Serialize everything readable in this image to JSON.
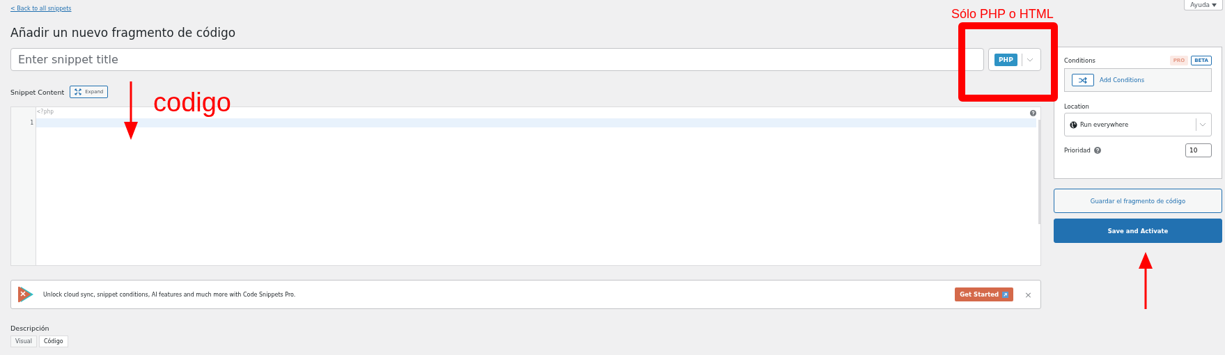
{
  "help_button": {
    "label": "Ayuda"
  },
  "back_link": "< Back to all snippets",
  "page_title": "Añadir un nuevo fragmento de código",
  "title_field": {
    "placeholder": "Enter snippet title"
  },
  "language": {
    "label": "PHP"
  },
  "content": {
    "label": "Snippet Content",
    "expand_button": "Expand",
    "opening_tag": "<?php",
    "line_numbers": [
      "1"
    ]
  },
  "banner": {
    "text": "Unlock cloud sync, snippet conditions, AI features and much more with Code Snippets Pro.",
    "button": "Get Started",
    "close": "×"
  },
  "description": {
    "label": "Descripción",
    "tabs": [
      {
        "label": "Visual",
        "selected": false
      },
      {
        "label": "Código",
        "selected": true
      }
    ]
  },
  "sidebar": {
    "conditions": {
      "label": "Conditions",
      "badges": [
        "PRO",
        "BETA"
      ],
      "button": "Add Conditions"
    },
    "location": {
      "label": "Location",
      "value": "Run everywhere"
    },
    "priority": {
      "label": "Prioridad",
      "value": "10"
    }
  },
  "buttons": [
    {
      "label": "Guardar el fragmento de código",
      "kind": "secondary"
    },
    {
      "label": "Save and Activate",
      "kind": "primary"
    }
  ],
  "annotations": [
    {
      "kind": "label",
      "text": "Sólo PHP o HTML"
    },
    {
      "kind": "label",
      "text": "codigo"
    }
  ]
}
